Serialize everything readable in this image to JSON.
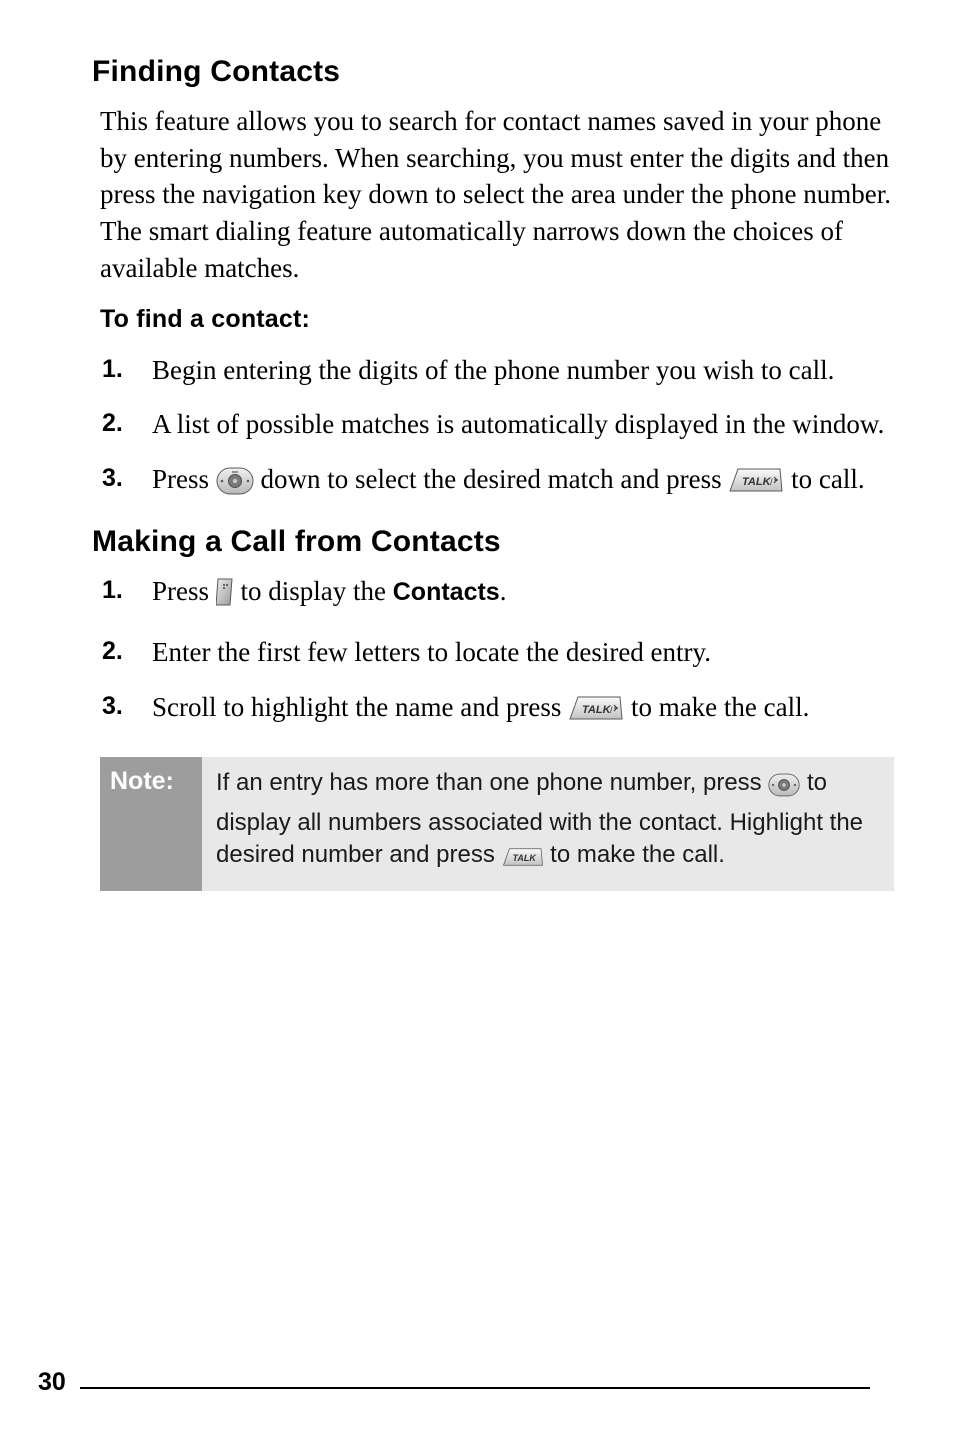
{
  "section1": {
    "heading": "Finding Contacts",
    "description": "This feature allows you to search for contact names saved in your phone by entering numbers. When searching, you must enter the digits and then press the navigation key down to select the area under the phone number. The smart dialing feature automatically narrows down the choices of available matches.",
    "subheading": "To find a contact:",
    "steps": {
      "s1": {
        "num": "1.",
        "text": "Begin entering the digits of the phone number you wish to call."
      },
      "s2": {
        "num": "2.",
        "text": "A list of possible matches is automatically displayed in the window."
      },
      "s3": {
        "num": "3.",
        "pre": "Press ",
        "mid": " down to select the desired match and press ",
        "post": " to call."
      }
    }
  },
  "section2": {
    "heading": "Making a Call from Contacts",
    "steps": {
      "s1": {
        "num": "1.",
        "pre": "Press ",
        "mid": " to display the ",
        "label": "Contacts",
        "post": "."
      },
      "s2": {
        "num": "2.",
        "text": "Enter the first few letters to locate the desired entry."
      },
      "s3": {
        "num": "3.",
        "pre": "Scroll to highlight the name and press ",
        "post": " to make the call."
      }
    }
  },
  "note": {
    "label": "Note:",
    "pre": "If an entry has more than one phone number, press ",
    "mid": " to display all numbers associated with the contact. Highlight the desired number and press ",
    "post": " to make the call."
  },
  "page_number": "30"
}
